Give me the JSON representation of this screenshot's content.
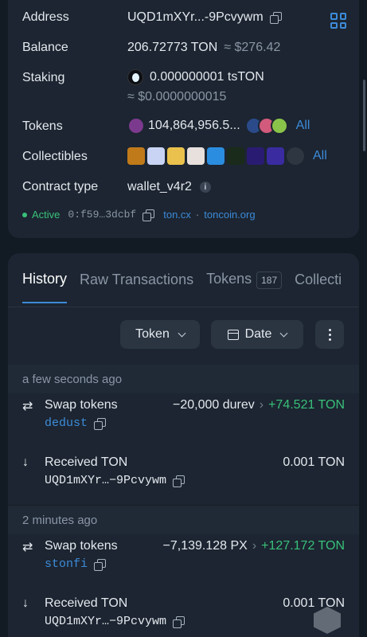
{
  "account": {
    "address_label": "Address",
    "address_value": "UQD1mXYr...-9Pcvywm",
    "balance_label": "Balance",
    "balance_ton": "206.72773 TON",
    "balance_usd": "≈ $276.42",
    "staking_label": "Staking",
    "staking_value": "0.000000001 tsTON",
    "staking_usd": "≈ $0.0000000015",
    "tokens_label": "Tokens",
    "tokens_value": "104,864,956.5...",
    "tokens_all": "All",
    "collectibles_label": "Collectibles",
    "collectibles_all": "All",
    "contract_label": "Contract type",
    "contract_value": "wallet_v4r2",
    "status": "Active",
    "raw_address": "0:f59…3dcbf",
    "link_tonscan": "ton.cx",
    "link_sep": "·",
    "link_toncoin": "toncoin.org"
  },
  "tabs": [
    {
      "label": "History"
    },
    {
      "label": "Raw Transactions"
    },
    {
      "label": "Tokens",
      "count": "187"
    },
    {
      "label": "Collecti"
    }
  ],
  "filters": {
    "token": "Token",
    "date": "Date"
  },
  "history": [
    {
      "date": "a few seconds ago",
      "items": [
        {
          "icon": "swap-icon",
          "title": "Swap tokens",
          "sub": "dedust",
          "out": "−20,000 durev",
          "in": "+74.521 TON"
        },
        {
          "icon": "arrow-down-icon",
          "title": "Received TON",
          "sub": "UQD1mXYr…−9Pcvywm",
          "amount": "0.001 TON"
        }
      ]
    },
    {
      "date": "2 minutes ago",
      "items": [
        {
          "icon": "swap-icon",
          "title": "Swap tokens",
          "sub": "stonfi",
          "out": "−7,139.128 PX",
          "in": "+127.172 TON"
        },
        {
          "icon": "arrow-down-icon",
          "title": "Received TON",
          "sub": "UQD1mXYr…−9Pcvywm",
          "amount": "0.001 TON"
        }
      ]
    }
  ],
  "colors": {
    "background": "#121a24",
    "card": "#1c2531",
    "accent": "#3d8bd9",
    "positive": "#39c07a",
    "muted": "#8a96a6"
  }
}
